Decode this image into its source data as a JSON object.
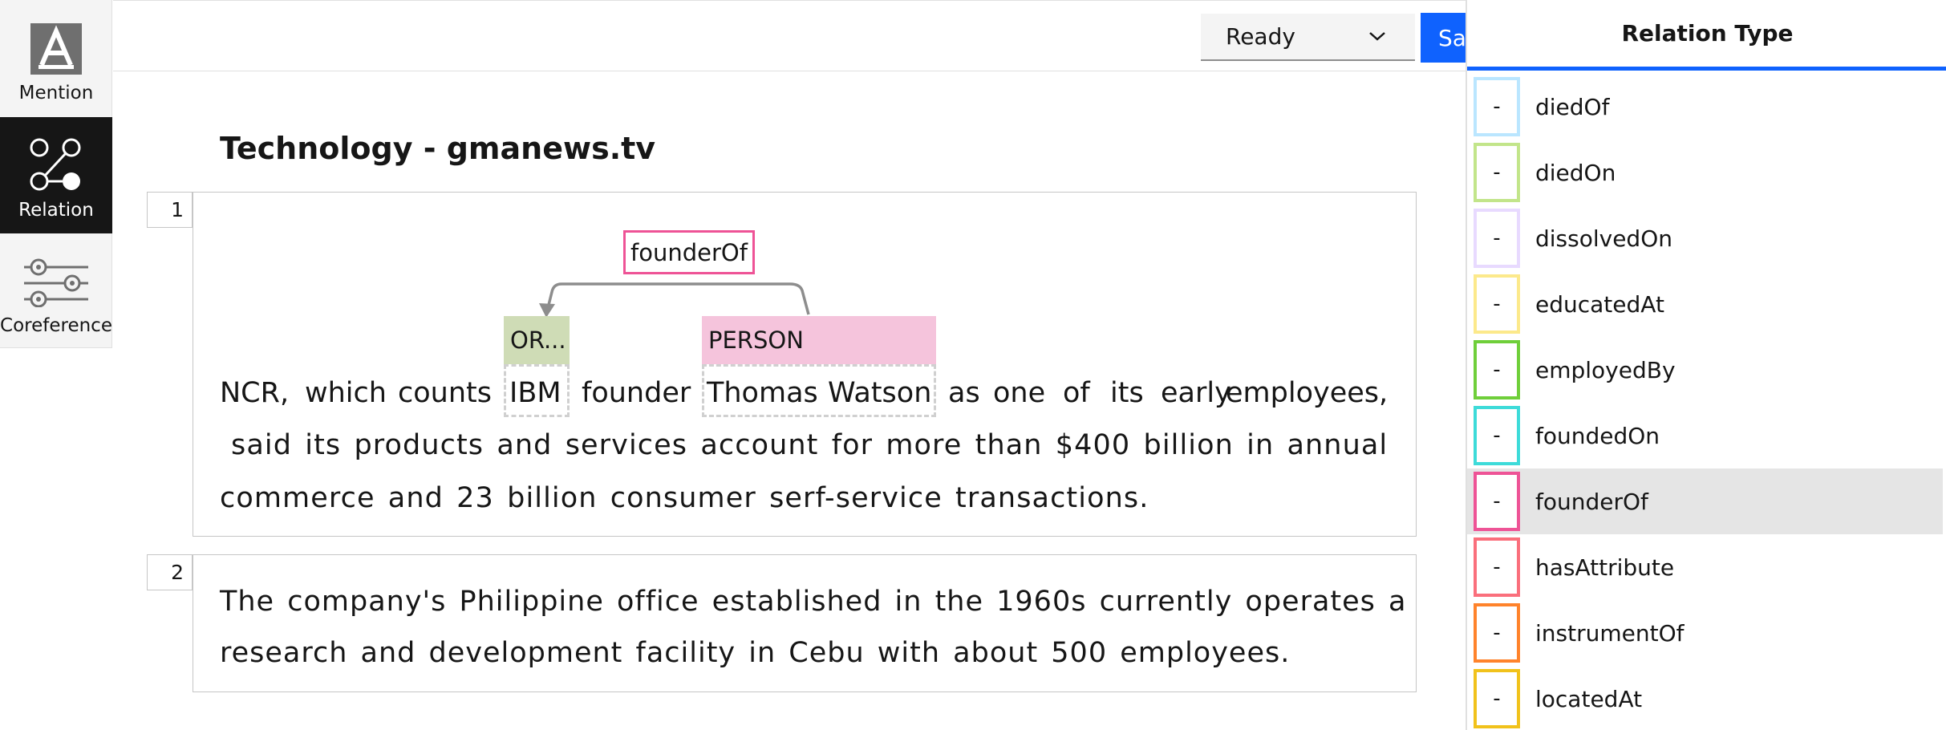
{
  "tools": {
    "mention_label": "Mention",
    "relation_label": "Relation",
    "coreference_label": "Coreference"
  },
  "header": {
    "status_value": "Ready",
    "save_label": "Save"
  },
  "document": {
    "title": "Technology - gmanews.tv",
    "sentences": [
      {
        "number": "1",
        "line1": {
          "w1": "NCR,",
          "w2": "which",
          "w3": "counts",
          "w4": "IBM",
          "w5": "founder",
          "w6": "Thomas",
          "w7": "Watson",
          "w8": "as",
          "w9": "one",
          "w10": "of",
          "w11": "its",
          "w12": "early",
          "w13": "employees,"
        },
        "line2": "said its products and services account for more than $400 billion in annual",
        "line3": "commerce and 23 billion consumer serf-service transactions."
      },
      {
        "number": "2",
        "line1": "The company's Philippine office established in the 1960s currently operates a",
        "line2": "research and development facility in Cebu with about 500 employees."
      }
    ],
    "entities": {
      "org_label": "OR...",
      "person_label": "PERSON"
    },
    "relation_label": "founderOf"
  },
  "panel": {
    "title": "Relation Type",
    "items": [
      {
        "key": "-",
        "name": "diedOf",
        "color": "#bae6ff"
      },
      {
        "key": "-",
        "name": "diedOn",
        "color": "#c2e58a"
      },
      {
        "key": "-",
        "name": "dissolvedOn",
        "color": "#e8daff"
      },
      {
        "key": "-",
        "name": "educatedAt",
        "color": "#fce98b"
      },
      {
        "key": "-",
        "name": "employedBy",
        "color": "#6fcf3a"
      },
      {
        "key": "-",
        "name": "foundedOn",
        "color": "#3ddbd9"
      },
      {
        "key": "-",
        "name": "founderOf",
        "color": "#ee5396",
        "selected": true
      },
      {
        "key": "-",
        "name": "hasAttribute",
        "color": "#fa6f7c"
      },
      {
        "key": "-",
        "name": "instrumentOf",
        "color": "#ff832b"
      },
      {
        "key": "-",
        "name": "locatedAt",
        "color": "#f1c21b"
      }
    ]
  },
  "colors": {
    "accent": "#0f62fe",
    "org": "#cfdcb6",
    "person": "#f5c4dc",
    "relation": "#ee5396"
  }
}
